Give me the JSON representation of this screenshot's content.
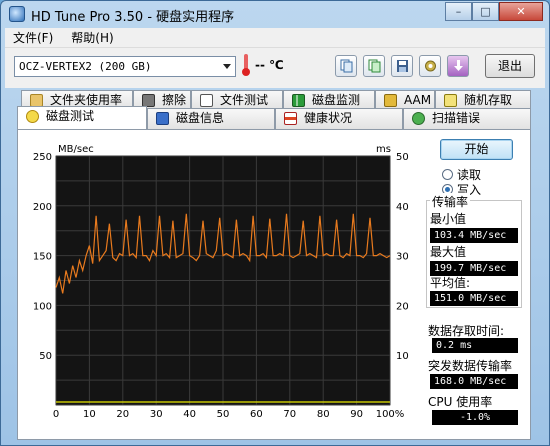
{
  "window": {
    "title": "HD Tune Pro 3.50 - 硬盘实用程序",
    "minimize": "–",
    "maximize": "□",
    "close": "✕"
  },
  "menu": {
    "file": "文件(F)",
    "help": "帮助(H)"
  },
  "toolbar": {
    "drive": "OCZ-VERTEX2 (200 GB)",
    "temperature": "-- ℃",
    "exit_label": "退出",
    "icons": [
      "copy-text-icon",
      "copy-image-icon",
      "save-icon",
      "options-icon",
      "download-icon"
    ]
  },
  "tabs_row1": [
    "文件夹使用率",
    "擦除",
    "文件测试",
    "磁盘监测",
    "AAM",
    "随机存取"
  ],
  "tabs_row2": [
    "磁盘测试",
    "磁盘信息",
    "健康状况",
    "扫描错误"
  ],
  "active_tab": "磁盘测试",
  "controls": {
    "start": "开始",
    "read": "读取",
    "write": "写入",
    "selected": "写入"
  },
  "stats": {
    "group_title": "传输率",
    "min_label": "最小值",
    "min_value": "103.4 MB/sec",
    "max_label": "最大值",
    "max_value": "199.7 MB/sec",
    "avg_label": "平均值:",
    "avg_value": "151.0 MB/sec",
    "access_label": "数据存取时间:",
    "access_value": "0.2 ms",
    "burst_label": "突发数据传输率",
    "burst_value": "168.0 MB/sec",
    "cpu_label": "CPU 使用率",
    "cpu_value": "-1.0%"
  },
  "chart_data": {
    "type": "line",
    "left_axis_label": "MB/sec",
    "right_axis_label": "ms",
    "left_ticks": [
      "250",
      "200",
      "150",
      "100",
      "50",
      ""
    ],
    "right_ticks": [
      "50",
      "40",
      "30",
      "20",
      "10",
      ""
    ],
    "x_ticks": [
      "0",
      "10",
      "20",
      "30",
      "40",
      "50",
      "60",
      "70",
      "80",
      "90",
      "100%"
    ],
    "ylim": [
      0,
      250
    ],
    "series": [
      {
        "color": "#e87a1e",
        "x": [
          0,
          1,
          2,
          3,
          4,
          5,
          6,
          7,
          8,
          9,
          10,
          11,
          12,
          13,
          14,
          15,
          16,
          17,
          18,
          19,
          20,
          21,
          22,
          23,
          24,
          25,
          26,
          27,
          28,
          29,
          30,
          31,
          32,
          33,
          34,
          35,
          36,
          37,
          38,
          39,
          40,
          41,
          42,
          43,
          44,
          45,
          46,
          47,
          48,
          49,
          50,
          51,
          52,
          53,
          54,
          55,
          56,
          57,
          58,
          59,
          60,
          61,
          62,
          63,
          64,
          65,
          66,
          67,
          68,
          69,
          70,
          71,
          72,
          73,
          74,
          75,
          76,
          77,
          78,
          79,
          80,
          81,
          82,
          83,
          84,
          85,
          86,
          87,
          88,
          89,
          90,
          91,
          92,
          93,
          94,
          95,
          96,
          97,
          98,
          99,
          100
        ],
        "values": [
          118,
          128,
          112,
          135,
          122,
          140,
          128,
          145,
          135,
          150,
          160,
          142,
          190,
          145,
          150,
          155,
          182,
          148,
          145,
          152,
          150,
          186,
          150,
          152,
          148,
          190,
          150,
          150,
          145,
          155,
          150,
          190,
          150,
          152,
          148,
          185,
          148,
          150,
          152,
          192,
          150,
          148,
          145,
          150,
          185,
          152,
          150,
          148,
          155,
          188,
          150,
          152,
          150,
          148,
          186,
          150,
          152,
          150,
          145,
          190,
          150,
          150,
          152,
          148,
          187,
          150,
          150,
          152,
          150,
          192,
          150,
          148,
          150,
          152,
          185,
          150,
          152,
          150,
          148,
          190,
          150,
          152,
          150,
          150,
          186,
          150,
          148,
          152,
          150,
          192,
          150,
          150,
          148,
          152,
          188,
          150,
          150,
          152,
          150,
          148,
          150
        ]
      },
      {
        "color": "#e6e600",
        "x": [
          0,
          10,
          20,
          30,
          40,
          50,
          60,
          70,
          80,
          90,
          100
        ],
        "values": [
          3,
          3,
          3,
          3,
          3,
          3,
          3,
          3,
          3,
          3,
          3
        ]
      }
    ]
  }
}
